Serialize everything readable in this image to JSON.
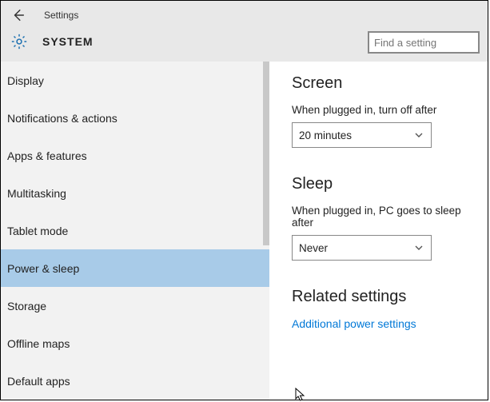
{
  "header": {
    "app_title": "Settings",
    "page_title": "SYSTEM",
    "search_placeholder": "Find a setting"
  },
  "sidebar": {
    "items": [
      {
        "label": "Display",
        "selected": false
      },
      {
        "label": "Notifications & actions",
        "selected": false
      },
      {
        "label": "Apps & features",
        "selected": false
      },
      {
        "label": "Multitasking",
        "selected": false
      },
      {
        "label": "Tablet mode",
        "selected": false
      },
      {
        "label": "Power & sleep",
        "selected": true
      },
      {
        "label": "Storage",
        "selected": false
      },
      {
        "label": "Offline maps",
        "selected": false
      },
      {
        "label": "Default apps",
        "selected": false
      }
    ]
  },
  "content": {
    "screen": {
      "heading": "Screen",
      "label": "When plugged in, turn off after",
      "value": "20 minutes"
    },
    "sleep": {
      "heading": "Sleep",
      "label": "When plugged in, PC goes to sleep after",
      "value": "Never"
    },
    "related": {
      "heading": "Related settings",
      "link": "Additional power settings"
    }
  }
}
